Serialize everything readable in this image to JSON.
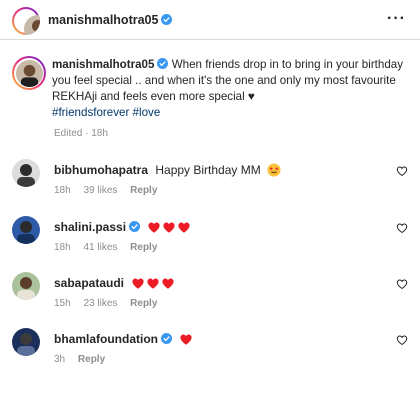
{
  "post": {
    "username": "manishmalhotra05",
    "more_icon": "more-horizontal-icon"
  },
  "caption": {
    "author": "manishmalhotra05",
    "text": "When friends drop in to bring in your birthday you feel special .. and when it's the one and only my most favourite REKHAji and feels even more special ♥",
    "hashtags": "#friendsforever #love",
    "edited": "Edited · 18h"
  },
  "comments": [
    {
      "username": "bibhumohapatra",
      "text": "Happy Birthday MM",
      "emoji": "star-struck-emoji",
      "time": "18h",
      "likes": "39 likes",
      "reply": "Reply"
    },
    {
      "username": "shalini.passi",
      "text": "",
      "emoji": "three-red-hearts",
      "time": "18h",
      "likes": "41 likes",
      "reply": "Reply"
    },
    {
      "username": "sabapataudi",
      "text": "",
      "emoji": "three-red-hearts",
      "time": "15h",
      "likes": "23 likes",
      "reply": "Reply"
    },
    {
      "username": "bhamlafoundation",
      "text": "",
      "emoji": "red-heart",
      "time": "3h",
      "likes": "",
      "reply": "Reply"
    }
  ],
  "colors": {
    "verified": "#3897f0",
    "hashtag": "#00376b",
    "muted": "#8e8e8e",
    "heart_red": "#ed1c24"
  }
}
